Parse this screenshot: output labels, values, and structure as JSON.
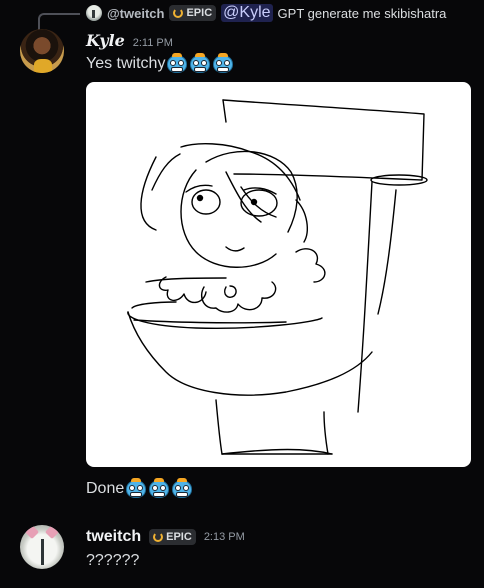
{
  "reply": {
    "username": "@tweitch",
    "tag": "EPIC",
    "mention": "@Kyle",
    "text": "GPT generate me skibishatra"
  },
  "messages": [
    {
      "username": "Kyle",
      "timestamp": "2:11 PM",
      "text": "Yes twitchy",
      "emoji": [
        "robot-face-emoji",
        "robot-face-emoji",
        "robot-face-emoji"
      ],
      "followup_text": "Done",
      "followup_emoji": [
        "robot-face-emoji",
        "robot-face-emoji",
        "robot-face-emoji"
      ]
    },
    {
      "username": "tweitch",
      "tag": "EPIC",
      "timestamp": "2:13 PM",
      "text": "??????"
    }
  ],
  "colors": {
    "background": "#070709",
    "mention_bg": "#5865f2",
    "tag_icon": "#f0b232",
    "image_bg": "#ffffff"
  }
}
